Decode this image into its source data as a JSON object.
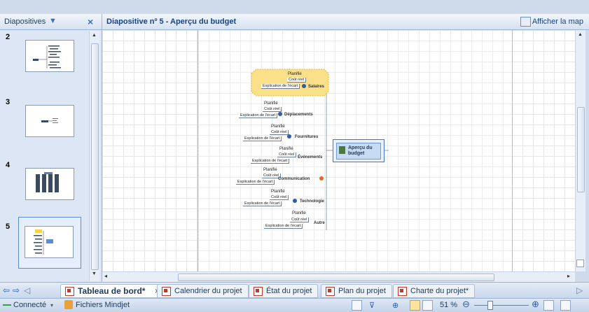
{
  "slides_panel": {
    "title": "Diapositives",
    "slide_numbers": [
      "2",
      "3",
      "4",
      "5"
    ]
  },
  "main": {
    "title": "Diapositive nº 5 - Aperçu du budget",
    "map_toggle": "Afficher la map"
  },
  "mindmap": {
    "central": "Aperçu du budget",
    "leaf_labels": {
      "a": "Planifié",
      "b": "Coût réel",
      "c": "Explication de l'écart"
    },
    "branches": [
      "Salaires",
      "Déplacements",
      "Fournitures",
      "Événements",
      "Communication",
      "Technologie",
      "Autre"
    ]
  },
  "tabs": [
    {
      "label": "Tableau de bord*"
    },
    {
      "label": "Calendrier du projet"
    },
    {
      "label": "État du projet"
    },
    {
      "label": "Plan du projet"
    },
    {
      "label": "Charte du projet*"
    }
  ],
  "status": {
    "connection": "Connecté",
    "files": "Fichiers Mindjet",
    "zoom": "51 %"
  },
  "colors": {
    "accent": "#15428b",
    "highlight": "#f9d24a"
  }
}
